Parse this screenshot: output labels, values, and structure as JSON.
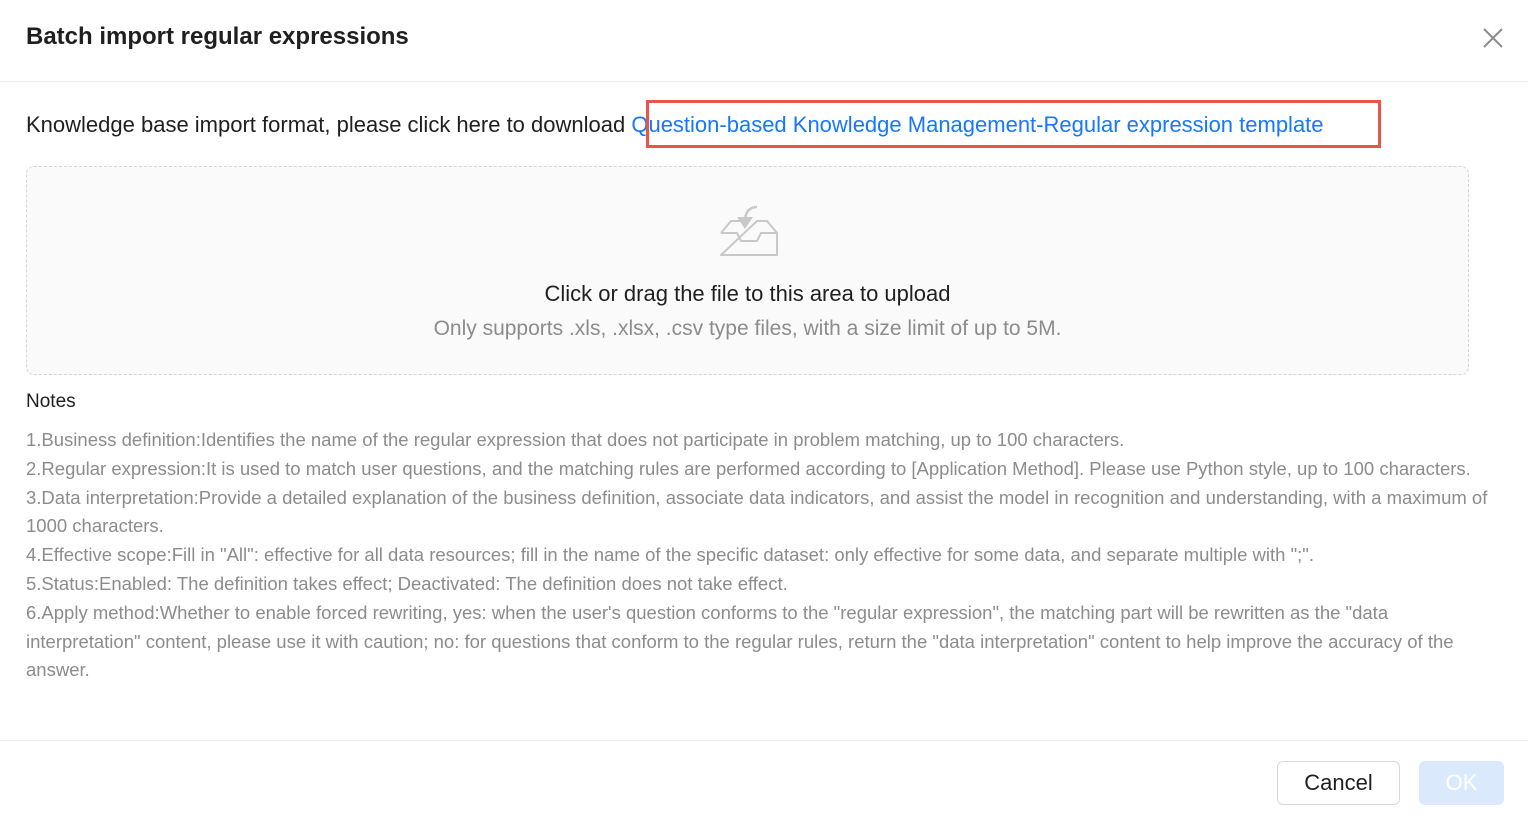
{
  "dialog": {
    "title": "Batch import regular expressions",
    "close_icon": "close-icon"
  },
  "download": {
    "prefix": "Knowledge base import format, please click here to download ",
    "link_text": "Question-based Knowledge Management-Regular expression template",
    "link_color": "#1677ff",
    "highlight_color": "#e8554a"
  },
  "upload": {
    "icon": "inbox-download-icon",
    "text": "Click or drag the file to this area to upload",
    "hint": "Only supports .xls, .xlsx, .csv type files, with a size limit of up to 5M."
  },
  "notes": {
    "title": "Notes",
    "items": [
      "1.Business definition:Identifies the name of the regular expression that does not participate in problem matching, up to 100 characters.",
      "2.Regular expression:It is used to match user questions, and the matching rules are performed according to [Application Method]. Please use Python style, up to 100 characters.",
      "3.Data interpretation:Provide a detailed explanation of the business definition, associate data indicators, and assist the model in recognition and understanding, with a maximum of 1000 characters.",
      "4.Effective scope:Fill in \"All\": effective for all data resources; fill in the name of the specific dataset: only effective for some data, and separate multiple with \";\".",
      "5.Status:Enabled: The definition takes effect; Deactivated: The definition does not take effect.",
      "6.Apply method:Whether to enable forced rewriting, yes: when the user's question conforms to the \"regular expression\", the matching part will be rewritten as the \"data interpretation\" content, please use it with caution; no: for questions that conform to the regular rules, return the \"data interpretation\" content to help improve the accuracy of the answer."
    ]
  },
  "footer": {
    "cancel_label": "Cancel",
    "ok_label": "OK",
    "ok_color": "#dbe9fd"
  }
}
